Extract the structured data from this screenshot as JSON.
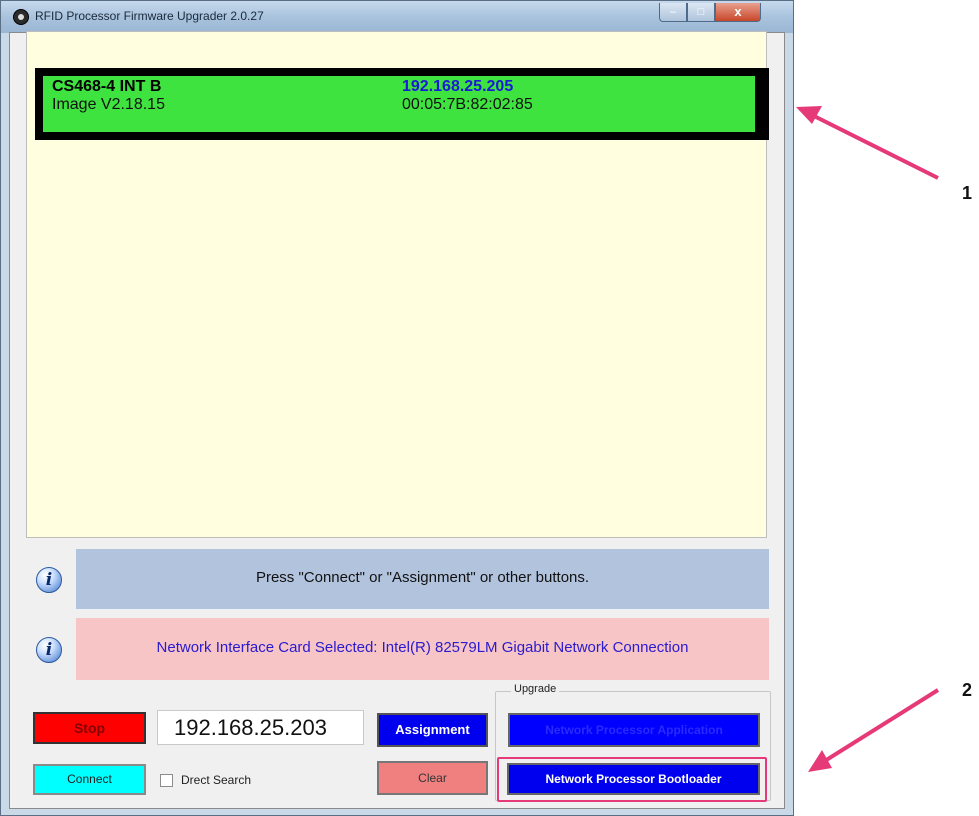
{
  "window": {
    "title": "RFID Processor Firmware Upgrader 2.0.27",
    "minimize_glyph": "–",
    "maximize_glyph": "□",
    "close_glyph": "x"
  },
  "device_list": {
    "devices": [
      {
        "name": "CS468-4 INT B",
        "image_version": "Image V2.18.15",
        "ip": "192.168.25.205",
        "mac": "00:05:7B:82:02:85",
        "status_color": "#3fe33f"
      }
    ]
  },
  "status_message": "Press \"Connect\" or \"Assignment\" or other buttons.",
  "nic_message": "Network Interface Card Selected: Intel(R) 82579LM Gigabit Network Connection",
  "info_icon_glyph": "i",
  "controls": {
    "stop_label": "Stop",
    "ip_value": "192.168.25.203",
    "assignment_label": "Assignment",
    "connect_label": "Connect",
    "direct_search_label": "Drect Search",
    "direct_search_checked": false,
    "clear_label": "Clear"
  },
  "upgrade": {
    "group_label": "Upgrade",
    "app_button_label": "Network Processor Application",
    "bootloader_button_label": "Network Processor Bootloader"
  },
  "callouts": {
    "one": "1",
    "two": "2"
  },
  "colors": {
    "accent_pink": "#e63a78",
    "device_online": "#3fe33f",
    "stop_red": "#ff0000",
    "assign_blue": "#0000ee",
    "connect_cyan": "#00ffff",
    "clear_salmon": "#f08080"
  }
}
